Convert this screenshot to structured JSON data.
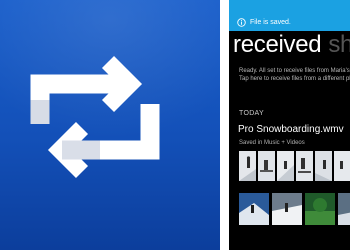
{
  "app_tile": {
    "icon": "sync-arrows-icon",
    "background_color": "#1350b8"
  },
  "phone": {
    "toast": {
      "text": "File is saved.",
      "icon": "info-circle-icon",
      "color": "#1ba1e2"
    },
    "pivot": {
      "active_label": "received",
      "next_label": "sha"
    },
    "status_lines": [
      "Ready. All set to receive files from Maria's",
      "Tap here to receive files from a different phone"
    ],
    "section_header": "TODAY",
    "file": {
      "title": "Pro Snowboarding.wmv",
      "meta": "Saved in Music + Videos"
    }
  }
}
